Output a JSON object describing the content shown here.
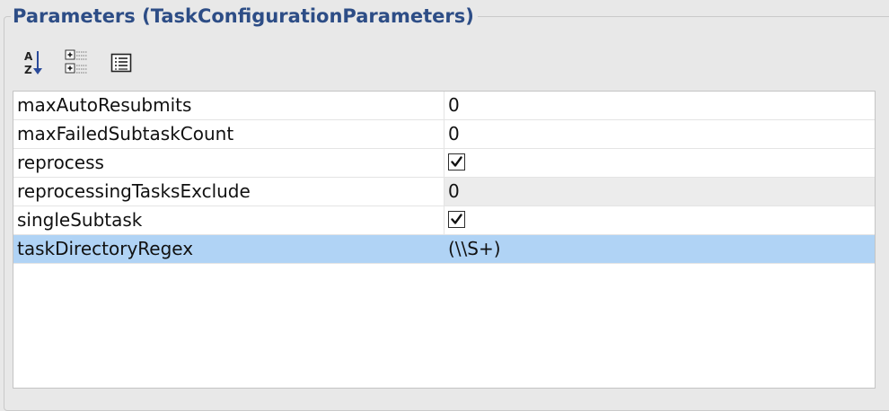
{
  "panel": {
    "title": "Parameters (TaskConfigurationParameters)"
  },
  "toolbar": {
    "buttons": [
      {
        "name": "sort-alphabetically",
        "icon": "sort-az-icon"
      },
      {
        "name": "categorized-view",
        "icon": "categories-tree-icon"
      },
      {
        "name": "show-description",
        "icon": "description-list-icon"
      }
    ]
  },
  "properties": {
    "rows": [
      {
        "name": "maxAutoResubmits",
        "type": "text",
        "value": "0",
        "editable": true,
        "selected": false
      },
      {
        "name": "maxFailedSubtaskCount",
        "type": "text",
        "value": "0",
        "editable": true,
        "selected": false
      },
      {
        "name": "reprocess",
        "type": "checkbox",
        "checked": true,
        "editable": true,
        "selected": false
      },
      {
        "name": "reprocessingTasksExclude",
        "type": "text",
        "value": "0",
        "editable": false,
        "selected": false
      },
      {
        "name": "singleSubtask",
        "type": "checkbox",
        "checked": true,
        "editable": true,
        "selected": false
      },
      {
        "name": "taskDirectoryRegex",
        "type": "text",
        "value": "(\\\\S+)",
        "editable": true,
        "selected": true
      }
    ]
  },
  "colors": {
    "title": "#2d4d86",
    "selection": "#b0d3f5",
    "readonly_cell": "#ececec",
    "background": "#e8e8e8"
  }
}
